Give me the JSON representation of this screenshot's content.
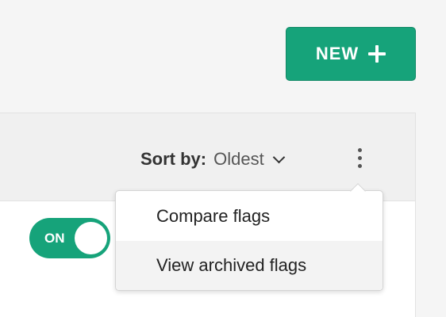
{
  "header": {
    "new_button": {
      "label": "NEW",
      "icon": "plus-icon"
    }
  },
  "toolbar": {
    "sort_by_label": "Sort by:",
    "sort_value": "Oldest",
    "sort_icon": "chevron-down-icon",
    "more_icon": "kebab-menu-icon"
  },
  "menu": {
    "items": [
      {
        "label": "Compare flags"
      },
      {
        "label": "View archived flags"
      }
    ]
  },
  "flag": {
    "toggle_label": "ON"
  },
  "colors": {
    "accent": "#16a37a",
    "panel_header": "#f0f0f0",
    "page_background": "#f5f5f5",
    "menu_hover": "#f3f3f3"
  }
}
